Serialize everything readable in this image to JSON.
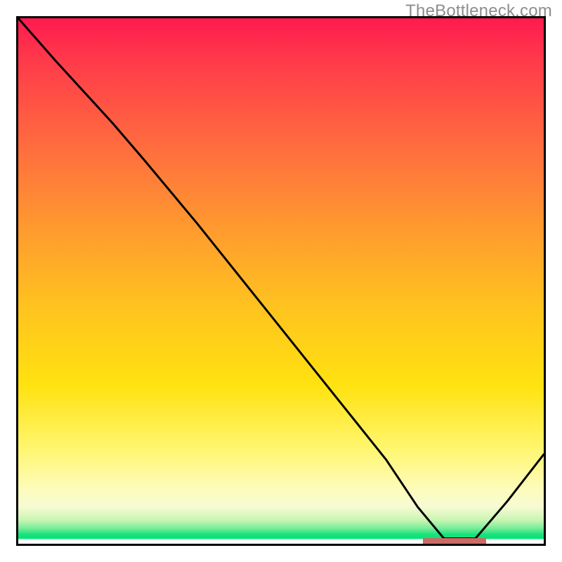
{
  "watermark": "TheBottleneck.com",
  "chart_data": {
    "type": "line",
    "title": "",
    "xlabel": "",
    "ylabel": "",
    "xlim": [
      0,
      100
    ],
    "ylim": [
      0,
      100
    ],
    "grid": false,
    "series": [
      {
        "name": "curve",
        "x": [
          0,
          7,
          18,
          24,
          34,
          46,
          58,
          70,
          76,
          81,
          87,
          93,
          100
        ],
        "y": [
          100,
          92,
          80,
          73,
          61,
          46,
          31,
          16,
          7,
          1,
          1,
          8,
          17
        ]
      }
    ],
    "marker": {
      "x_start": 77,
      "x_end": 89,
      "y": 0.6
    },
    "gradient_stops": [
      {
        "pos": 0,
        "color": "#ff1a4f"
      },
      {
        "pos": 40,
        "color": "#ff9a2f"
      },
      {
        "pos": 70,
        "color": "#ffe210"
      },
      {
        "pos": 92,
        "color": "#fdfcbf"
      },
      {
        "pos": 98,
        "color": "#18e07a"
      },
      {
        "pos": 100,
        "color": "#ffffff"
      }
    ]
  }
}
